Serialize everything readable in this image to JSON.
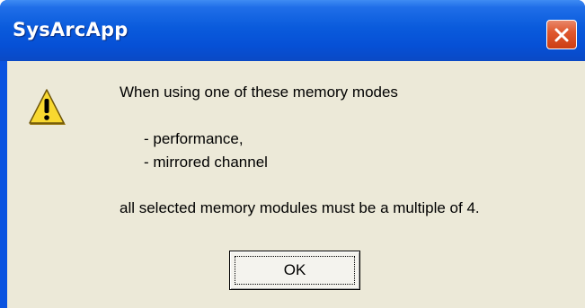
{
  "window": {
    "title": "SysArcApp"
  },
  "message": {
    "line1": "When using one of these memory modes",
    "item1": "- performance,",
    "item2": "- mirrored channel",
    "line4": "all selected memory modules must be a multiple of 4."
  },
  "buttons": {
    "ok_label": "OK"
  },
  "icons": {
    "warning": "warning-icon",
    "close": "close-icon"
  },
  "colors": {
    "titlebar": "#0a5bdc",
    "client": "#ece9d8",
    "close_button": "#e0592f",
    "warning_fill": "#f8d830"
  }
}
